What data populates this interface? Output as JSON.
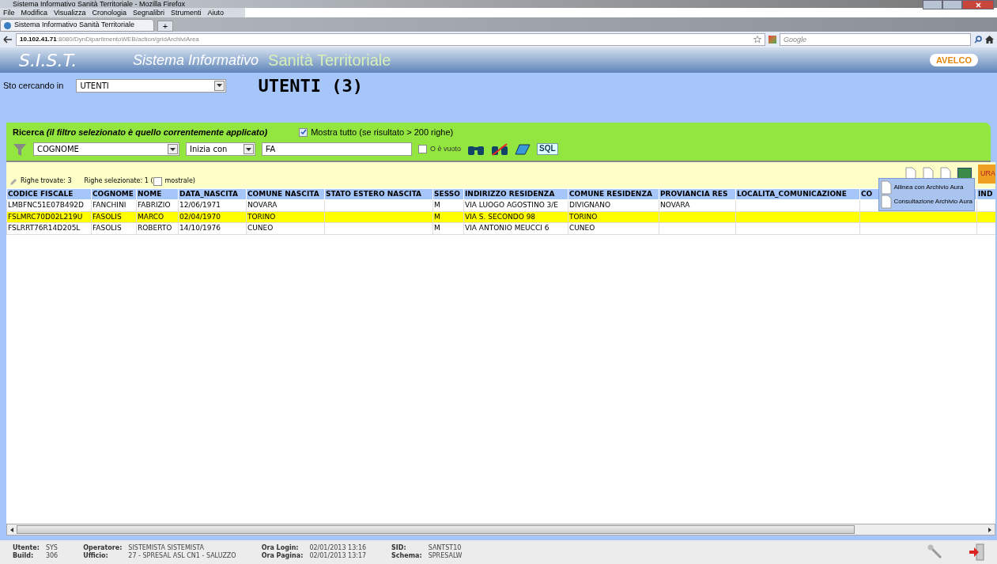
{
  "window": {
    "title": "Sistema Informativo Sanità Territoriale - Mozilla Firefox"
  },
  "menu": [
    "File",
    "Modifica",
    "Visualizza",
    "Cronologia",
    "Segnalibri",
    "Strumenti",
    "Aiuto"
  ],
  "browser_tab": {
    "title": "Sistema Informativo Sanità Territoriale",
    "new_tab": "+"
  },
  "address": {
    "host": "10.102.41.71",
    "rest": ":8080/DynDipartimentoWEB/action/gridArchiviArea"
  },
  "web_search": {
    "placeholder": "Google"
  },
  "banner": {
    "logo": "S.I.S.T.",
    "subtitle": "Sistema Informativo",
    "title": "Sanità Territoriale",
    "brand": "AVELCO"
  },
  "archive": {
    "label": "Sto cercando in",
    "value": "UTENTI",
    "heading": "UTENTI (3)"
  },
  "search": {
    "title": "Ricerca",
    "note": "(il filtro selezionato è quello correntemente applicato)",
    "show_all": {
      "label": "Mostra tutto (se risultato > 200 righe)",
      "checked": true
    },
    "field": "COGNOME",
    "operator": "Inizia con",
    "value": "FA",
    "empty": {
      "label": "O è vuoto",
      "checked": false
    },
    "sql": "SQL"
  },
  "results": {
    "found": "Righe trovate: 3",
    "selected_prefix": "Righe selezionate: 1 (",
    "show_selected": {
      "label": "mostrale)",
      "checked": false
    },
    "aura_label": "URA"
  },
  "popup_menu": [
    "Allinea con Archivio Aura",
    "Consultazione Archivio Aura"
  ],
  "table": {
    "columns": [
      "CODICE FISCALE",
      "COGNOME",
      "NOME",
      "DATA_NASCITA",
      "COMUNE NASCITA",
      "STATO ESTERO NASCITA",
      "SESSO",
      "INDIRIZZO RESIDENZA",
      "COMUNE RESIDENZA",
      "PROVIANCIA RES",
      "LOCALITA_COMUNICAZIONE",
      "CO",
      "IND"
    ],
    "rows": [
      {
        "selected": false,
        "cells": [
          "LMBFNC51E07B492D",
          "FANCHINI",
          "FABRIZIO",
          "12/06/1971",
          "NOVARA",
          "",
          "M",
          "VIA LUOGO AGOSTINO 3/E",
          "DIVIGNANO",
          "NOVARA",
          "",
          "",
          ""
        ]
      },
      {
        "selected": true,
        "cells": [
          "FSLMRC70D02L219U",
          "FASOLIS",
          "MARCO",
          "02/04/1970",
          "TORINO",
          "",
          "M",
          "VIA S. SECONDO 98",
          "TORINO",
          "",
          "",
          "",
          ""
        ]
      },
      {
        "selected": false,
        "cells": [
          "FSLRRT76R14D205L",
          "FASOLIS",
          "ROBERTO",
          "14/10/1976",
          "CUNEO",
          "",
          "M",
          "VIA ANTONIO MEUCCI 6",
          "CUNEO",
          "",
          "",
          "",
          ""
        ]
      }
    ]
  },
  "status_bar": [
    [
      {
        "label": "Utente:",
        "value": "SYS"
      },
      {
        "label": "Build:",
        "value": "306"
      }
    ],
    [
      {
        "label": "Operatore:",
        "value": "SISTEMISTA SISTEMISTA"
      },
      {
        "label": "Ufficio:",
        "value": "27 - SPRESAL ASL CN1 - SALUZZO"
      }
    ],
    [
      {
        "label": "Ora Login:",
        "value": "02/01/2013 13:16"
      },
      {
        "label": "Ora Pagina:",
        "value": "02/01/2013 13:17"
      }
    ],
    [
      {
        "label": "SID:",
        "value": "SANTST10"
      },
      {
        "label": "Schema:",
        "value": "SPRESALW"
      }
    ]
  ]
}
